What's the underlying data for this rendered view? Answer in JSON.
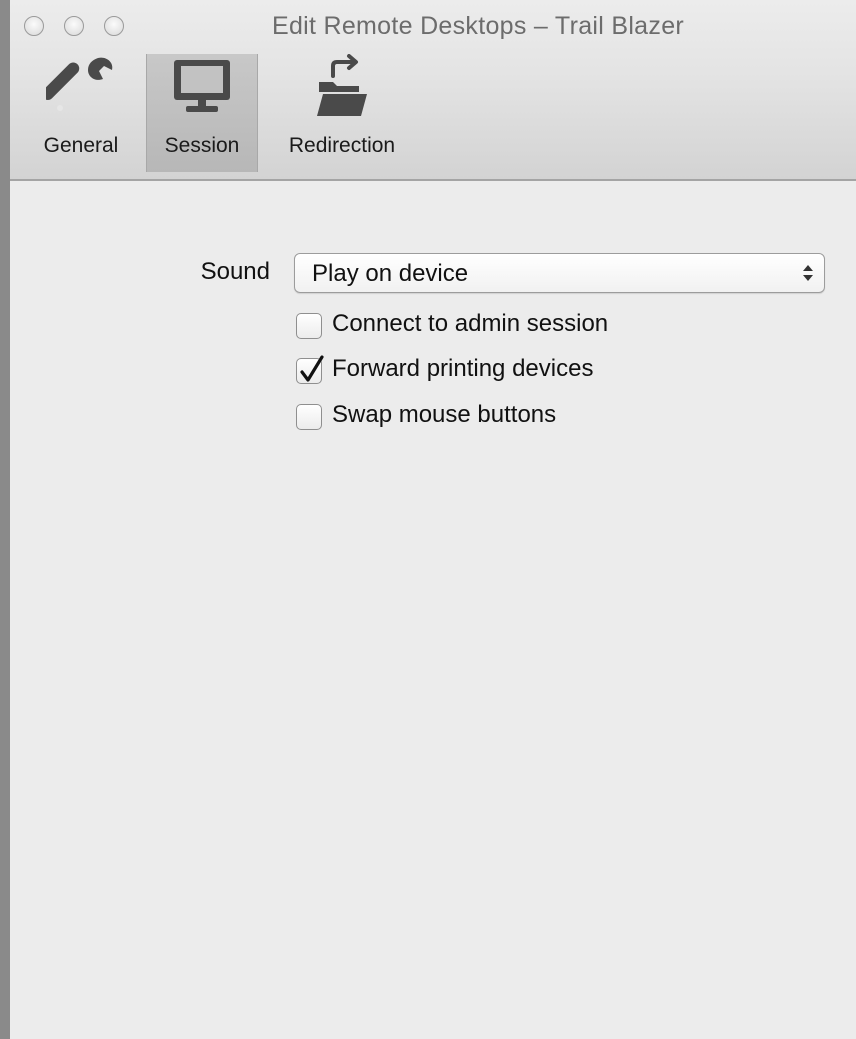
{
  "window": {
    "title": "Edit Remote Desktops – Trail Blazer"
  },
  "toolbar": {
    "items": [
      {
        "label": "General",
        "icon": "wrench-icon",
        "selected": false
      },
      {
        "label": "Session",
        "icon": "monitor-icon",
        "selected": true
      },
      {
        "label": "Redirection",
        "icon": "folder-redirect-icon",
        "selected": false
      }
    ]
  },
  "session": {
    "sound": {
      "label": "Sound",
      "value": "Play on device"
    },
    "options": [
      {
        "label": "Connect to admin session",
        "checked": false
      },
      {
        "label": "Forward printing devices",
        "checked": true
      },
      {
        "label": "Swap mouse buttons",
        "checked": false
      }
    ]
  },
  "colors": {
    "window_background": "#ececec",
    "toolbar_selected": "#bfbfbf",
    "icon": "#4a4a4a",
    "desktop": "#8a8a8a"
  }
}
